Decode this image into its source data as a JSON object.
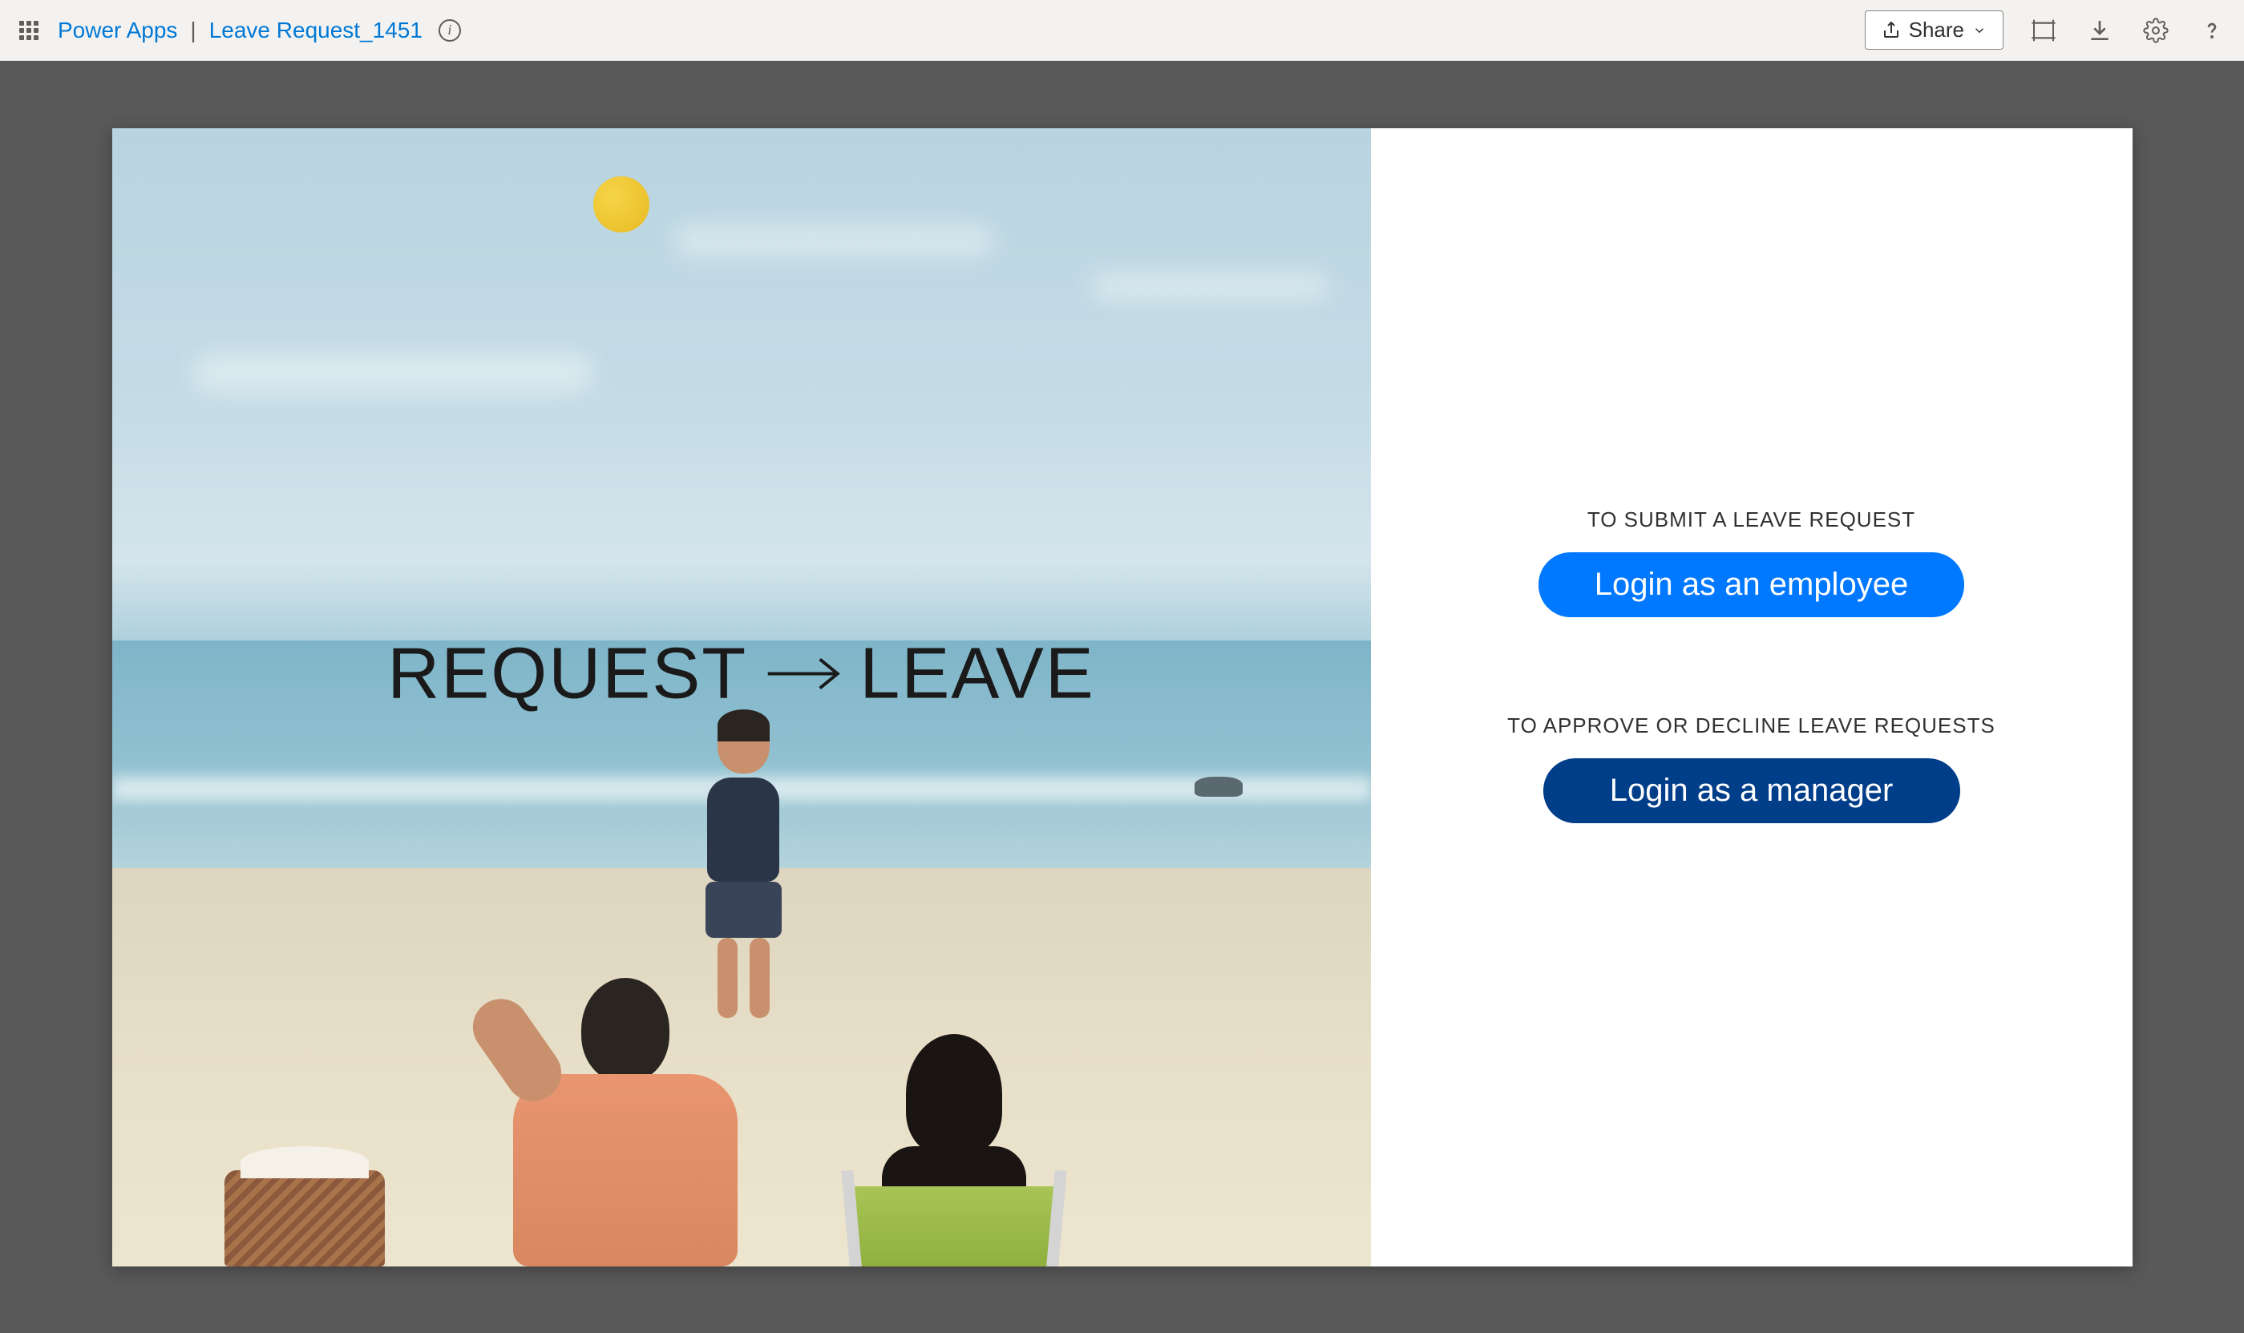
{
  "header": {
    "product_name": "Power Apps",
    "separator": "|",
    "app_name": "Leave Request_1451",
    "share_label": "Share"
  },
  "app": {
    "title_left": "REQUEST",
    "title_right": "LEAVE",
    "employee": {
      "label": "TO SUBMIT A LEAVE REQUEST",
      "button": "Login as an employee"
    },
    "manager": {
      "label": "TO APPROVE OR DECLINE LEAVE REQUESTS",
      "button": "Login as a manager"
    }
  }
}
